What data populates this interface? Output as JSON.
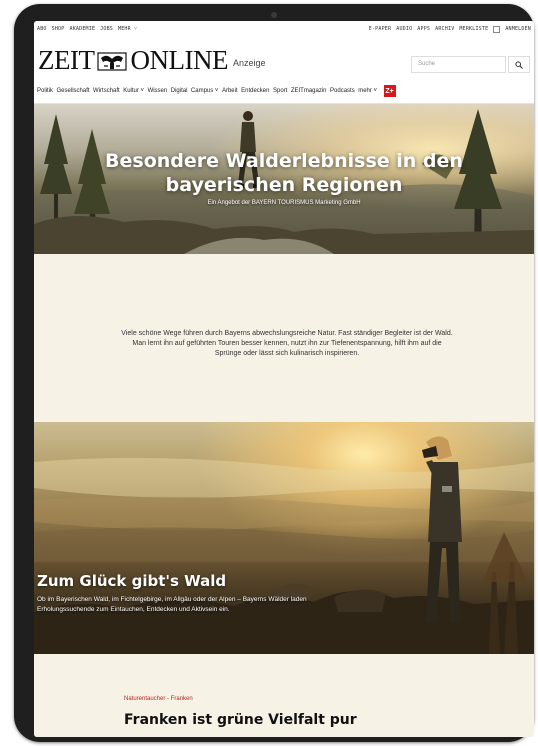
{
  "topbar": {
    "left_links": [
      "ABO",
      "SHOP",
      "AKADEMIE",
      "JOBS",
      "MEHR ˅"
    ],
    "right_links": [
      "E-PAPER",
      "AUDIO",
      "APPS",
      "ARCHIV",
      "MERKLISTE"
    ],
    "login": "ANMELDEN"
  },
  "header": {
    "logo_left": "ZEIT",
    "logo_right": "ONLINE",
    "anzeige": "Anzeige",
    "search_placeholder": "Suche"
  },
  "nav": {
    "items": [
      "Politik",
      "Gesellschaft",
      "Wirtschaft",
      "Kultur ˅",
      "Wissen",
      "Digital",
      "Campus ˅",
      "Arbeit",
      "Entdecken",
      "Sport",
      "ZEITmagazin",
      "Podcasts",
      "mehr ˅"
    ],
    "plus_badge": "Z+"
  },
  "hero": {
    "title_line1": "Besondere Walderlebnisse in den",
    "title_line2": "bayerischen Regionen",
    "subtitle": "Ein Angebot der BAYERN TOURISMUS Marketing GmbH"
  },
  "intro": {
    "text": "Viele schöne Wege führen durch Bayerns abwechslungsreiche Natur. Fast ständiger Begleiter ist der Wald. Man lernt ihn auf geführten Touren besser kennen, nutzt ihn zur Tiefenentspannung, hilft ihm auf die Sprünge oder lässt sich kulinarisch inspirieren."
  },
  "section2": {
    "title": "Zum Glück gibt's Wald",
    "text": "Ob im Bayerischen Wald, im Fichtelgebirge, im Allgäu oder der Alpen – Bayerns Wälder laden Erholungssuchende zum Eintauchen, Entdecken und Aktivsein ein."
  },
  "article": {
    "kicker": "Naturentaucher - Franken",
    "title": "Franken ist grüne Vielfalt pur"
  },
  "colors": {
    "accent_red": "#d8161b",
    "kicker_red": "#b5281e",
    "page_bg": "#f7f2e6"
  }
}
